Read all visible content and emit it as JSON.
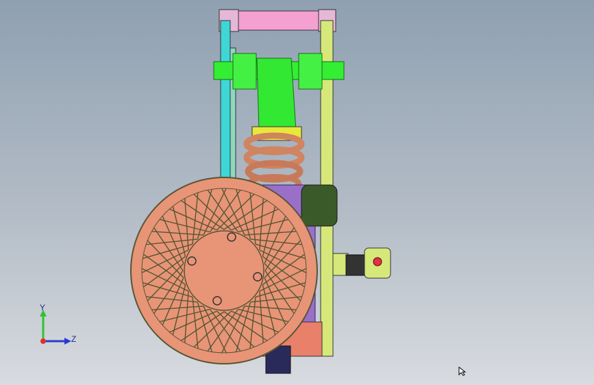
{
  "triad": {
    "y_label": "Y",
    "z_label": "Z"
  },
  "colors": {
    "background_top": "#8fa0b1",
    "background_bottom": "#d8dbe0",
    "wheel": "#e89477",
    "frame_green": "#33ee33",
    "mount_pink": "#f4a0d0",
    "link_cyan": "#3fd6d6",
    "link_yellow": "#d6e87a",
    "gearbox_purple": "#9a6fc8",
    "dark_navy": "#2a2a5a",
    "spring_copper": "#d08460"
  }
}
